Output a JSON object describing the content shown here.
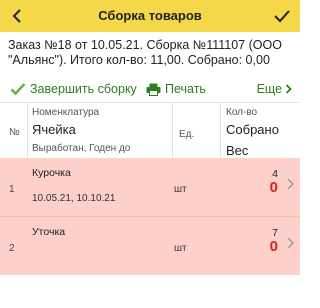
{
  "header": {
    "title": "Сборка товаров",
    "back_icon": "chevron-left-icon",
    "confirm_icon": "checkmark-icon",
    "color": "#f5d84a"
  },
  "info": {
    "text": "Заказ №18 от 10.05.21. Сборка №111107 (ООО \"Альянс\"). Итого кол-во: 11,00. Собрано: 0,00"
  },
  "toolbar": {
    "finish_label": "Завершить сборку",
    "print_label": "Печать",
    "more_label": "Еще",
    "accent": "#2e7d1e"
  },
  "columns": {
    "num": "№",
    "nomenclature": "Номенклатура",
    "cell": "Ячейка",
    "produced": "Выработан, Годен до",
    "unit": "Ед.",
    "qty": "Кол-во",
    "collected": "Собрано",
    "weight": "Вес"
  },
  "rows": [
    {
      "index": "1",
      "name": "Курочка",
      "meta": "10.05.21, 10.10.21",
      "unit": "шт",
      "qty": "4",
      "collected": "0"
    },
    {
      "index": "2",
      "name": "Уточка",
      "meta": "",
      "unit": "шт",
      "qty": "7",
      "collected": "0"
    }
  ],
  "colors": {
    "row_bg": "#fdd0c9",
    "collected": "#e0211b"
  }
}
